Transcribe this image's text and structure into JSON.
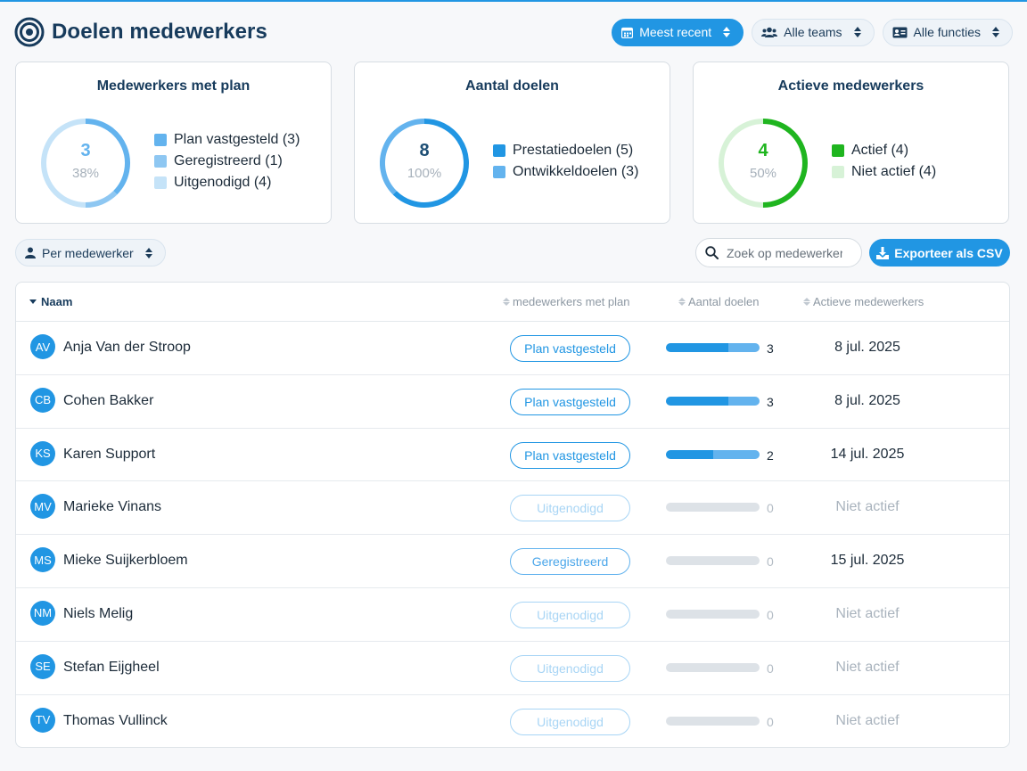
{
  "header": {
    "title": "Doelen medewerkers",
    "sort_filter": "Meest recent",
    "team_filter": "Alle teams",
    "function_filter": "Alle functies"
  },
  "cards": [
    {
      "title": "Medewerkers met plan",
      "value": "3",
      "percent": "38%",
      "value_color": "#63b3ee",
      "legend": [
        {
          "label": "Plan vastgesteld (3)",
          "color": "#63b3ee",
          "value": 3
        },
        {
          "label": "Geregistreerd (1)",
          "color": "#8ec7f2",
          "value": 1
        },
        {
          "label": "Uitgenodigd (4)",
          "color": "#c5e3f8",
          "value": 4
        }
      ]
    },
    {
      "title": "Aantal doelen",
      "value": "8",
      "percent": "100%",
      "value_color": "#1d4e74",
      "legend": [
        {
          "label": "Prestatiedoelen (5)",
          "color": "#2196e3",
          "value": 5
        },
        {
          "label": "Ontwikkeldoelen (3)",
          "color": "#63b3ee",
          "value": 3
        }
      ]
    },
    {
      "title": "Actieve medewerkers",
      "value": "4",
      "percent": "50%",
      "value_color": "#1fb51f",
      "legend": [
        {
          "label": "Actief (4)",
          "color": "#1fb51f",
          "value": 4
        },
        {
          "label": "Niet actief (4)",
          "color": "#d7f2d7",
          "value": 4
        }
      ]
    }
  ],
  "toolbar": {
    "group_by": "Per medewerker",
    "search_placeholder": "Zoek op medewerker",
    "export_label": "Exporteer als CSV"
  },
  "table": {
    "columns": {
      "name": "Naam",
      "plan": "medewerkers met plan",
      "goals": "Aantal doelen",
      "active": "Actieve medewerkers"
    },
    "rows": [
      {
        "initials": "AV",
        "name": "Anja Van der Stroop",
        "status": "Plan vastgesteld",
        "status_type": "set",
        "perf": 2,
        "dev": 1,
        "goals": "3",
        "active": "8 jul. 2025"
      },
      {
        "initials": "CB",
        "name": "Cohen Bakker",
        "status": "Plan vastgesteld",
        "status_type": "set",
        "perf": 2,
        "dev": 1,
        "goals": "3",
        "active": "8 jul. 2025"
      },
      {
        "initials": "KS",
        "name": "Karen Support",
        "status": "Plan vastgesteld",
        "status_type": "set",
        "perf": 1,
        "dev": 1,
        "goals": "2",
        "active": "14 jul. 2025"
      },
      {
        "initials": "MV",
        "name": "Marieke Vinans",
        "status": "Uitgenodigd",
        "status_type": "invited",
        "perf": 0,
        "dev": 0,
        "goals": "0",
        "active": "Niet actief"
      },
      {
        "initials": "MS",
        "name": "Mieke Suijkerbloem",
        "status": "Geregistreerd",
        "status_type": "registered",
        "perf": 0,
        "dev": 0,
        "goals": "0",
        "active": "15 jul. 2025"
      },
      {
        "initials": "NM",
        "name": "Niels Melig",
        "status": "Uitgenodigd",
        "status_type": "invited",
        "perf": 0,
        "dev": 0,
        "goals": "0",
        "active": "Niet actief"
      },
      {
        "initials": "SE",
        "name": "Stefan Eijgheel",
        "status": "Uitgenodigd",
        "status_type": "invited",
        "perf": 0,
        "dev": 0,
        "goals": "0",
        "active": "Niet actief"
      },
      {
        "initials": "TV",
        "name": "Thomas Vullinck",
        "status": "Uitgenodigd",
        "status_type": "invited",
        "perf": 0,
        "dev": 0,
        "goals": "0",
        "active": "Niet actief"
      }
    ]
  }
}
